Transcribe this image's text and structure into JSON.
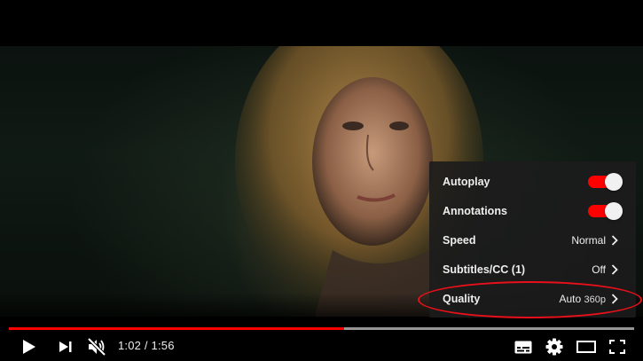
{
  "player": {
    "progress": {
      "played_fraction": 0.536,
      "loaded_fraction": 1.0
    },
    "time": {
      "current": "1:02",
      "separator": " / ",
      "duration": "1:56"
    },
    "controls": {
      "play_icon": "play-icon",
      "next_icon": "next-icon",
      "volume_icon": "volume-muted-icon",
      "subtitles_icon": "subtitles-icon",
      "settings_icon": "gear-icon",
      "theater_icon": "theater-mode-icon",
      "fullscreen_icon": "fullscreen-icon"
    }
  },
  "settings_menu": {
    "items": [
      {
        "label": "Autoplay",
        "type": "toggle",
        "on": true
      },
      {
        "label": "Annotations",
        "type": "toggle",
        "on": true
      },
      {
        "label": "Speed",
        "value": "Normal"
      },
      {
        "label": "Subtitles/CC (1)",
        "value": "Off"
      },
      {
        "label": "Quality",
        "value": "Auto",
        "value_detail": "360p"
      }
    ]
  },
  "colors": {
    "accent": "#ff0000",
    "annotation": "#e8101a",
    "menu_bg": "#1c1c1c"
  }
}
